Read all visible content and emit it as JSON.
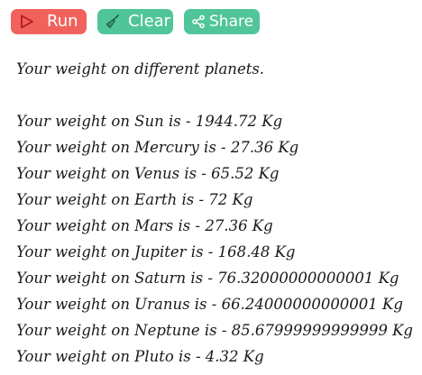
{
  "toolbar": {
    "run_label": "Run",
    "clear_label": "Clear",
    "share_label": "Share",
    "icons": {
      "run": "play-icon",
      "clear": "broom-icon",
      "share": "share-icon"
    },
    "colors": {
      "run": "#f2625c",
      "clear": "#50c59a",
      "share": "#50c59a"
    }
  },
  "output": {
    "heading": "Your weight on different planets.",
    "lines": [
      "Your weight on Sun is - 1944.72 Kg",
      "Your weight on Mercury is - 27.36 Kg",
      "Your weight on Venus is - 65.52 Kg",
      "Your weight on Earth is - 72 Kg",
      "Your weight on Mars is - 27.36 Kg",
      "Your weight on Jupiter is - 168.48 Kg",
      "Your weight on Saturn is - 76.32000000000001 Kg",
      "Your weight on Uranus is - 66.24000000000001 Kg",
      "Your weight on Neptune is - 85.67999999999999 Kg",
      "Your weight on Pluto is - 4.32 Kg"
    ]
  }
}
